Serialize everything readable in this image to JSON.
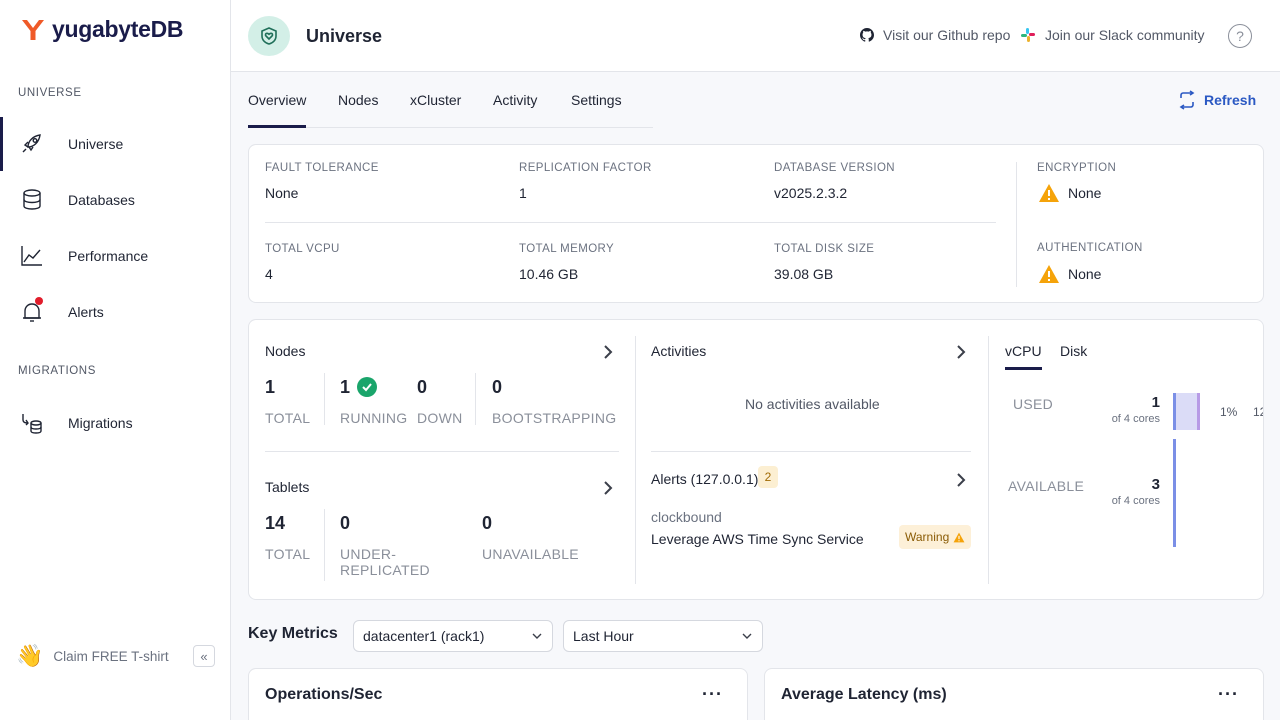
{
  "brand": {
    "name": "yugabyteDB"
  },
  "sidebar": {
    "sections": [
      {
        "label": "UNIVERSE"
      },
      {
        "label": "MIGRATIONS"
      }
    ],
    "items": [
      {
        "label": "Universe",
        "icon": "rocket-icon",
        "active": true
      },
      {
        "label": "Databases",
        "icon": "database-icon"
      },
      {
        "label": "Performance",
        "icon": "chart-line-icon"
      },
      {
        "label": "Alerts",
        "icon": "bell-icon",
        "has_notification": true
      },
      {
        "label": "Migrations",
        "icon": "migrations-icon"
      }
    ],
    "promo": {
      "label": "Claim FREE T-shirt",
      "icon": "waving-hand-icon"
    },
    "collapse_icon": "double-chevron-left-icon"
  },
  "header": {
    "title": "Universe",
    "icon": "heart-shield-icon",
    "github_link": "Visit our Github repo",
    "slack_link": "Join our Slack community",
    "help_icon": "question-circle-icon"
  },
  "tabs": [
    {
      "label": "Overview",
      "active": true
    },
    {
      "label": "Nodes"
    },
    {
      "label": "xCluster"
    },
    {
      "label": "Activity"
    },
    {
      "label": "Settings"
    }
  ],
  "refresh_label": "Refresh",
  "summary": {
    "fault_tolerance": {
      "label": "FAULT TOLERANCE",
      "value": "None"
    },
    "replication_factor": {
      "label": "REPLICATION FACTOR",
      "value": "1"
    },
    "database_version": {
      "label": "DATABASE VERSION",
      "value": "v2025.2.3.2"
    },
    "total_vcpu": {
      "label": "TOTAL VCPU",
      "value": "4"
    },
    "total_memory": {
      "label": "TOTAL MEMORY",
      "value": "10.46 GB"
    },
    "total_disk": {
      "label": "TOTAL DISK SIZE",
      "value": "39.08 GB"
    },
    "encryption": {
      "label": "ENCRYPTION",
      "value": "None"
    },
    "authentication": {
      "label": "AUTHENTICATION",
      "value": "None"
    }
  },
  "nodes": {
    "title": "Nodes",
    "total": {
      "value": "1",
      "label": "TOTAL"
    },
    "running": {
      "value": "1",
      "label": "RUNNING"
    },
    "down": {
      "value": "0",
      "label": "DOWN"
    },
    "bootstrapping": {
      "value": "0",
      "label": "BOOTSTRAPPING"
    }
  },
  "tablets": {
    "title": "Tablets",
    "total": {
      "value": "14",
      "label": "TOTAL"
    },
    "under_replicated": {
      "value": "0",
      "label_line1": "UNDER-",
      "label_line2": "REPLICATED"
    },
    "unavailable": {
      "value": "0",
      "label": "UNAVAILABLE"
    }
  },
  "activities": {
    "title": "Activities",
    "empty_message": "No activities available"
  },
  "alerts": {
    "title": "Alerts (127.0.0.1)",
    "count": "2",
    "item": {
      "source": "clockbound",
      "message": "Leverage AWS Time Sync Service",
      "severity": "Warning"
    }
  },
  "resources": {
    "tabs": [
      {
        "label": "vCPU",
        "active": true
      },
      {
        "label": "Disk"
      }
    ],
    "used": {
      "label": "USED",
      "value": "1",
      "sub": "of 4 cores",
      "pct_left": "1%",
      "pct_right": "12"
    },
    "available": {
      "label": "AVAILABLE",
      "value": "3",
      "sub": "of 4 cores"
    }
  },
  "key_metrics": {
    "title": "Key Metrics",
    "region_select": "datacenter1 (rack1)",
    "time_select": "Last Hour",
    "cards": [
      {
        "title": "Operations/Sec"
      },
      {
        "title": "Average Latency (ms)"
      }
    ]
  },
  "colors": {
    "brand": "#1a1c4a",
    "accent_link": "#2b59c3",
    "success": "#1aa56b",
    "warning": "#f5a30a",
    "notification": "#e11d2b"
  }
}
